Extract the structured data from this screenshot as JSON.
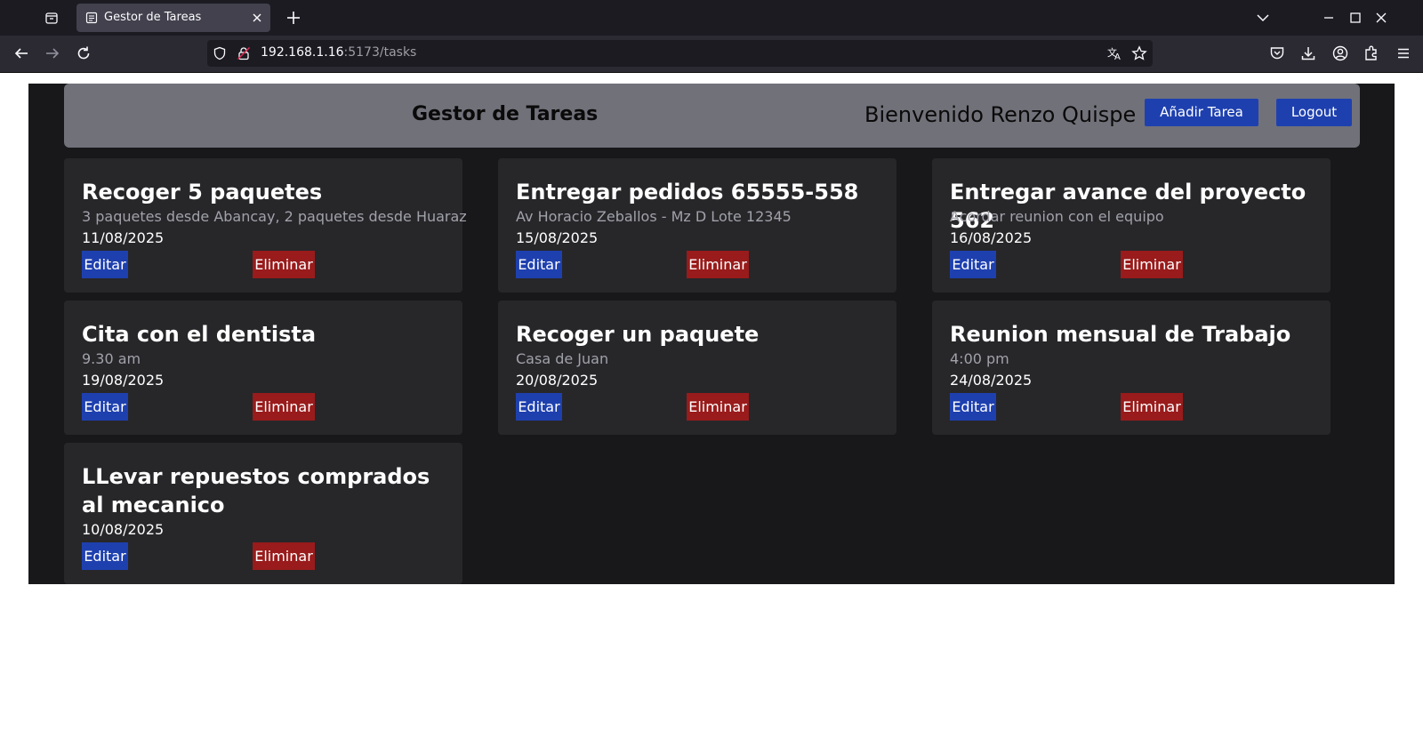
{
  "browser": {
    "tab_title": "Gestor de Tareas",
    "url_host": "192.168.1.16",
    "url_rest": ":5173/tasks"
  },
  "app": {
    "title": "Gestor de Tareas",
    "welcome": "Bienvenido Renzo Quispe",
    "add_task_label": "Añadir Tarea",
    "logout_label": "Logout"
  },
  "tasks": [
    {
      "title": "Recoger 5 paquetes",
      "description": "3 paquetes desde Abancay, 2 paquetes desde Huaraz",
      "date": "11/08/2025",
      "edit_label": "Editar",
      "delete_label": "Eliminar"
    },
    {
      "title": "Entregar pedidos 65555-558",
      "description": "Av Horacio Zeballos - Mz D Lote 12345",
      "date": "15/08/2025",
      "edit_label": "Editar",
      "delete_label": "Eliminar"
    },
    {
      "title": "Entregar avance del proyecto 562",
      "description": "Acordar reunion con el equipo",
      "date": "16/08/2025",
      "edit_label": "Editar",
      "delete_label": "Eliminar"
    },
    {
      "title": "Cita con el dentista",
      "description": "9.30 am",
      "date": "19/08/2025",
      "edit_label": "Editar",
      "delete_label": "Eliminar"
    },
    {
      "title": "Recoger un paquete",
      "description": "Casa de Juan",
      "date": "20/08/2025",
      "edit_label": "Editar",
      "delete_label": "Eliminar"
    },
    {
      "title": "Reunion mensual de Trabajo",
      "description": "4:00 pm",
      "date": "24/08/2025",
      "edit_label": "Editar",
      "delete_label": "Eliminar"
    },
    {
      "title": "LLevar repuestos comprados al mecanico",
      "description": "",
      "date": "10/08/2025",
      "edit_label": "Editar",
      "delete_label": "Eliminar"
    }
  ],
  "colors": {
    "primary_button": "#1e40af",
    "danger_button": "#991b1b",
    "card_bg": "#27272a",
    "app_bg": "#18181b",
    "header_bg": "#71717a"
  }
}
